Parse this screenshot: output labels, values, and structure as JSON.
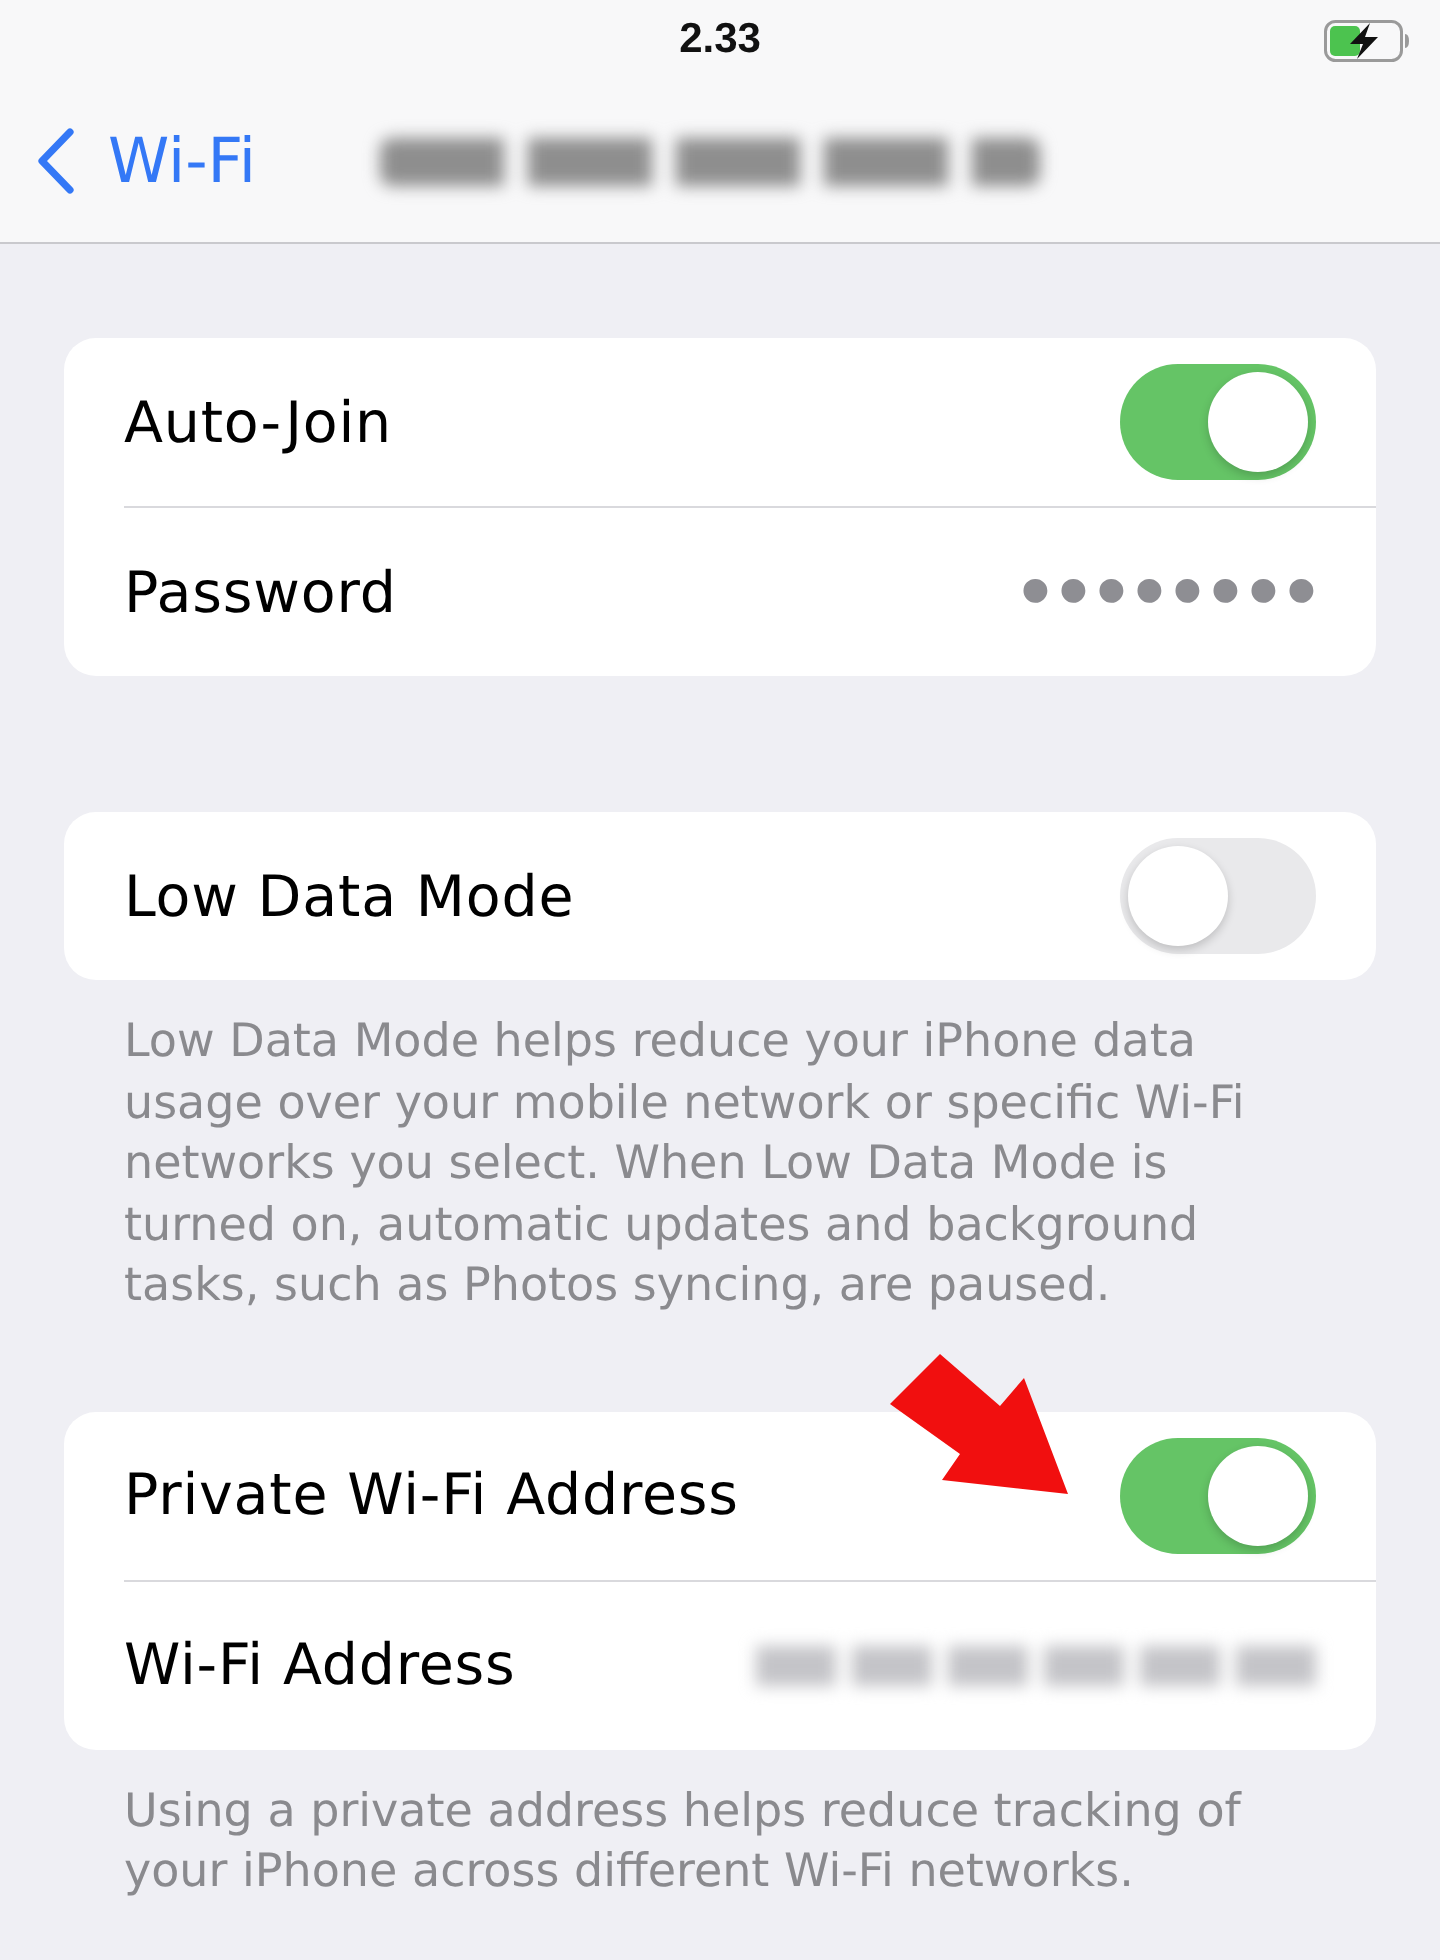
{
  "status_bar": {
    "time": "2.33",
    "battery": {
      "charging": true
    }
  },
  "nav": {
    "back_label": "Wi-Fi",
    "title_redacted": true
  },
  "groups": [
    {
      "rows": [
        {
          "kind": "toggle",
          "label": "Auto-Join",
          "on": true,
          "pointer_arrow": false
        },
        {
          "kind": "secret",
          "label": "Password",
          "value": "••••••••",
          "pointer_arrow": false
        }
      ]
    },
    {
      "rows": [
        {
          "kind": "toggle",
          "label": "Low Data Mode",
          "on": false,
          "pointer_arrow": false
        }
      ],
      "footer": "Low Data Mode helps reduce your iPhone data usage over your mobile network or specific Wi-Fi networks you select. When Low Data Mode is turned on, automatic updates and background tasks, such as Photos syncing, are paused."
    },
    {
      "rows": [
        {
          "kind": "toggle",
          "label": "Private Wi-Fi Address",
          "on": true,
          "pointer_arrow": true
        },
        {
          "kind": "redacted",
          "label": "Wi-Fi Address",
          "pointer_arrow": false
        }
      ],
      "footer": "Using a private address helps reduce tracking of your iPhone across different Wi-Fi networks."
    }
  ]
}
